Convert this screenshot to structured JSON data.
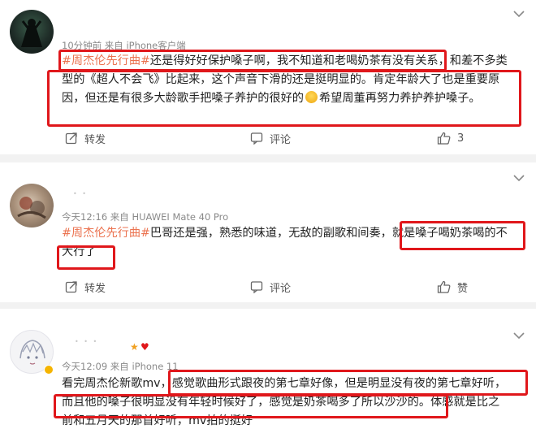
{
  "comments": [
    {
      "meta": "10分钟前 来自 iPhone客户端",
      "lines": [
        {
          "tag": "#周杰伦先行曲#",
          "rest": "还是得好好保护嗓子啊，我不知道和老喝奶茶有没有关系，和差不多类"
        },
        {
          "text": "型的《超人不会飞》比起来，这个声音下滑的还是挺明显的。肯定年龄大了也是重要原"
        },
        {
          "pre": "因，但还是有很多大龄歌手把嗓子养护的很好的",
          "post": "希望周董再努力养护养护嗓子。"
        }
      ],
      "actions": {
        "repost": "转发",
        "comment": "评论",
        "like": "3"
      }
    },
    {
      "meta": "今天12:16 来自 HUAWEI Mate 40 Pro",
      "lines": [
        {
          "tag": "#周杰伦先行曲#",
          "rest": "巴哥还是强，熟悉的味道，无敌的副歌和间奏，就是嗓子喝奶茶喝的不"
        },
        {
          "text": "大行了"
        }
      ],
      "actions": {
        "repost": "转发",
        "comment": "评论",
        "like": "赞"
      }
    },
    {
      "meta": "今天12:09 来自 iPhone 11",
      "lines": [
        {
          "text": "看完周杰伦新歌mv，感觉歌曲形式跟夜的第七章好像，但是明显没有夜的第七章好听，"
        },
        {
          "text": "而且他的嗓子很明显没有年轻时候好了，感觉是奶茶喝多了所以沙沙的。体感就是比之"
        },
        {
          "text": "前和五月天的那首好听，mv拍的挺好"
        }
      ]
    }
  ],
  "colors": {
    "tag": "#eb7350",
    "highlight": "#e0171b",
    "meta": "#8a8a8a"
  }
}
